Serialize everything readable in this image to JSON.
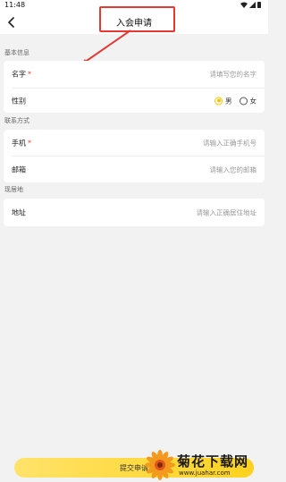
{
  "status_bar": {
    "time": "11:48"
  },
  "header": {
    "title": "入会申请"
  },
  "sections": {
    "basic": {
      "title": "基本信息",
      "name": {
        "label": "名字",
        "required": "*",
        "placeholder": "请填写您的名字"
      },
      "gender": {
        "label": "性别",
        "options": [
          "男",
          "女"
        ],
        "selected": "男"
      }
    },
    "contact": {
      "title": "联系方式",
      "phone": {
        "label": "手机",
        "required": "*",
        "placeholder": "请输入正确手机号"
      },
      "email": {
        "label": "邮箱",
        "placeholder": "请输入您的邮箱"
      }
    },
    "residence": {
      "title": "现居地",
      "address": {
        "label": "地址",
        "placeholder": "请输入正确居住地址"
      }
    }
  },
  "footer": {
    "submit_label": "提交申请"
  },
  "watermark": {
    "title": "菊花下载网",
    "url": "www.juahar.com"
  },
  "colors": {
    "accent": "#f5c400",
    "highlight": "#e53935"
  }
}
